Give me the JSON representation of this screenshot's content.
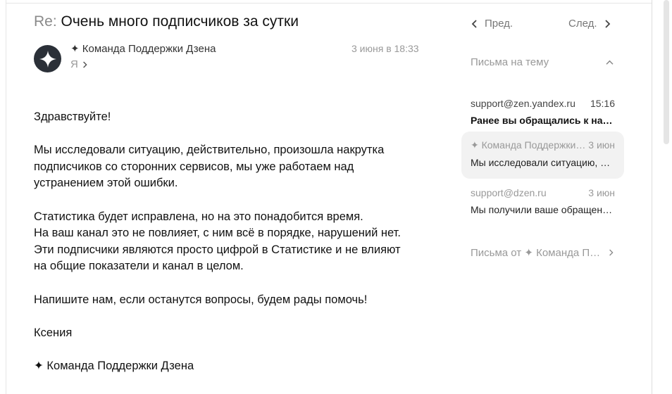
{
  "email": {
    "subject_prefix": "Re:",
    "subject": "Очень много подписчиков за сутки",
    "sender": "✦ Команда Поддержки Дзена",
    "recipient": "Я",
    "date": "3 июня в 18:33",
    "body": [
      "Здравствуйте!",
      "Мы исследовали ситуацию, действительно, произошла накрутка\nподписчиков со сторонних сервисов, мы уже работаем над\nустранением этой ошибки.",
      "Статистика будет исправлена, но на это понадобится время.\nНа ваш канал это не повлияет, с ним всё в порядке, нарушений нет.\nЭти подписчики являются просто цифрой в Статистике и не влияют\nна общие показатели и канал в целом.",
      "Напишите нам, если останутся вопросы, будем рады помочь!",
      "Ксения",
      "✦ Команда Поддержки Дзена"
    ]
  },
  "nav": {
    "prev_label": "Пред.",
    "next_label": "След."
  },
  "thread": {
    "title": "Письма на тему",
    "items": [
      {
        "from": "support@zen.yandex.ru",
        "date": "15:16",
        "preview": "Ранее вы обращались к нам...",
        "unread": true,
        "active": false
      },
      {
        "from": "✦ Команда Поддержки Дзена",
        "date": "3 июн",
        "preview": "Мы исследовали ситуацию, действительно...",
        "unread": false,
        "active": true
      },
      {
        "from": "support@dzen.ru",
        "date": "3 июн",
        "preview": "Мы получили ваше обращение...",
        "unread": false,
        "active": false
      }
    ],
    "letters_from_label": "Письма от ✦ Команда Поддержки Дзена"
  },
  "colors": {
    "text": "#111111",
    "muted": "#999999",
    "active_bg": "#f2f2f2",
    "avatar_bg": "#2b3038"
  }
}
